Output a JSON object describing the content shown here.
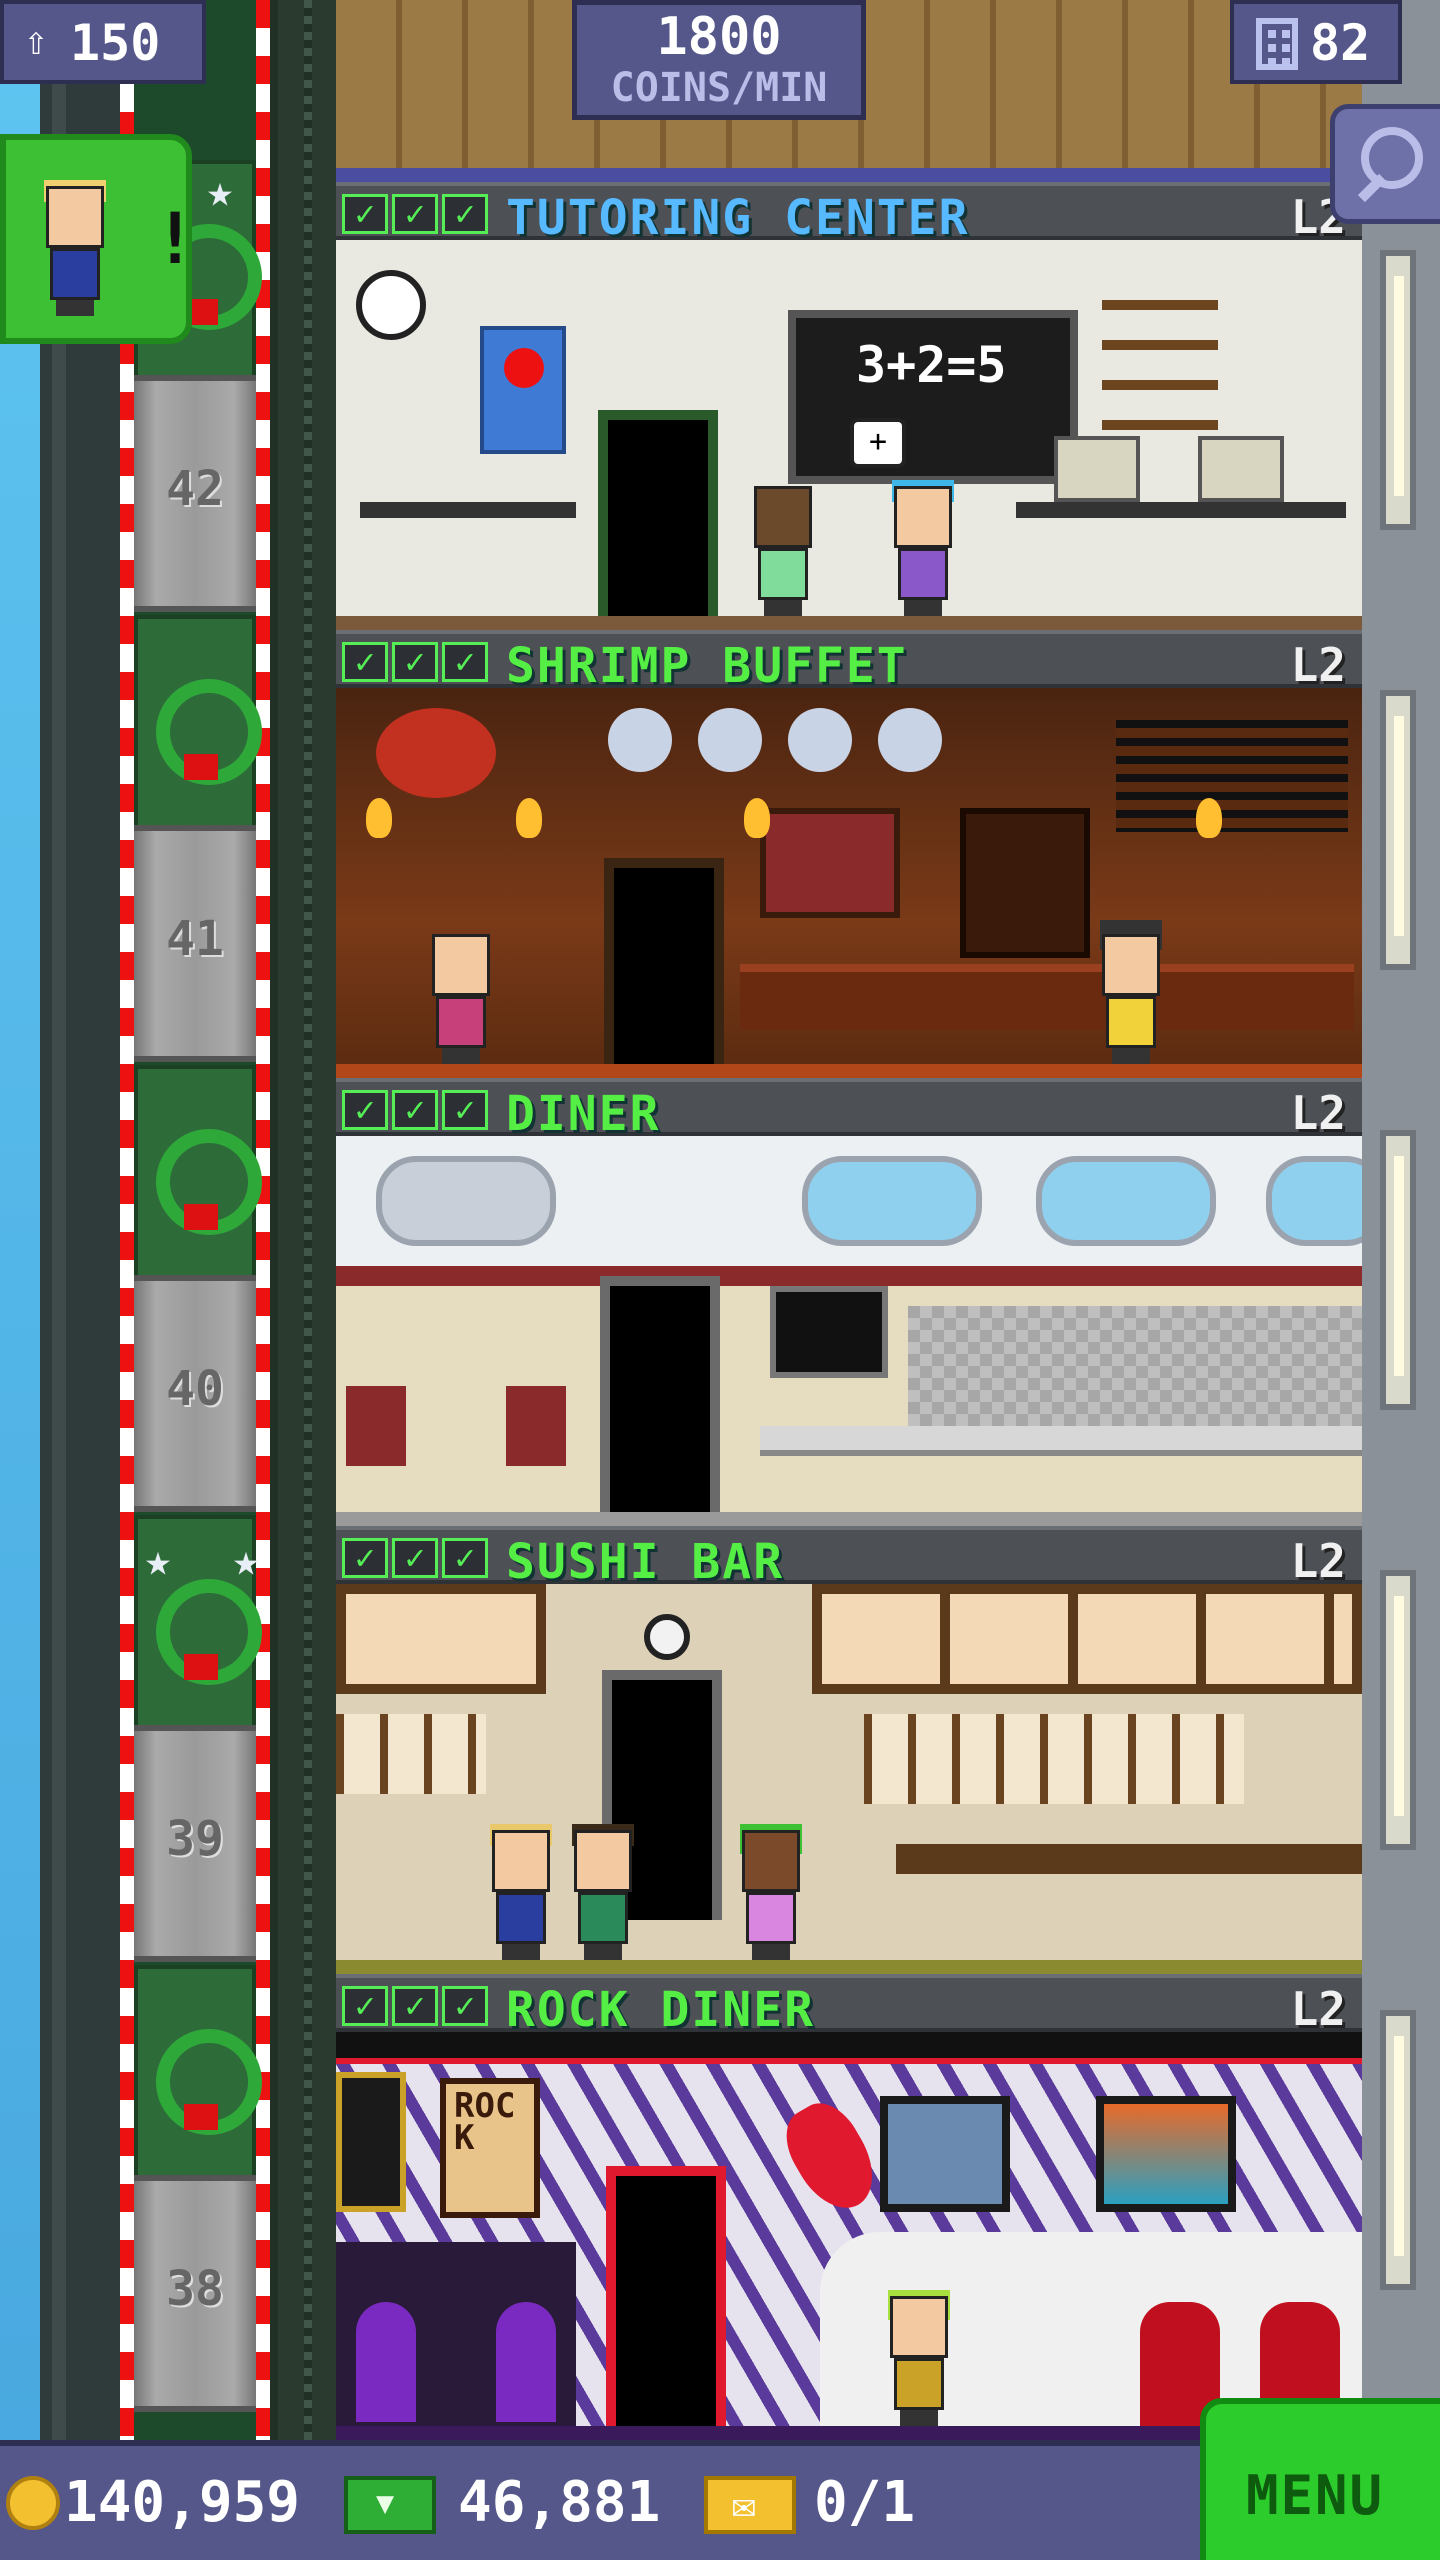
{
  "status": {
    "population": "150",
    "coins_per_min_value": "1800",
    "coins_per_min_label": "COINS/MIN",
    "floor_count": "82"
  },
  "floors": [
    {
      "name": "TUTORING CENTER",
      "level": "L2",
      "color": "#57b9ff",
      "board_text": "3+2=5"
    },
    {
      "name": "SHRIMP BUFFET",
      "level": "L2",
      "color": "#55ee44"
    },
    {
      "name": "DINER",
      "level": "L2",
      "color": "#55ee44"
    },
    {
      "name": "SUSHI BAR",
      "level": "L2",
      "color": "#55ee44"
    },
    {
      "name": "ROCK DINER",
      "level": "L2",
      "color": "#55ee44",
      "sign_text": "ROCK"
    }
  ],
  "elevator": {
    "floor_numbers": [
      "42",
      "41",
      "40",
      "39",
      "38"
    ]
  },
  "bottom_bar": {
    "coins": "140,959",
    "bux": "46,881",
    "tickets": "0/1",
    "menu_label": "MENU"
  },
  "icons": {
    "population": "people-icon",
    "floors": "building-icon",
    "search": "magnifier-icon",
    "coins": "coin-icon",
    "bux": "bux-icon",
    "tickets": "ticket-icon",
    "checkmark": "checkmark-icon"
  },
  "colors": {
    "hud_bg": "#55578a",
    "menu_green": "#2ccc2c",
    "floor_name_green": "#55ee44",
    "floor_name_blue": "#57b9ff"
  }
}
